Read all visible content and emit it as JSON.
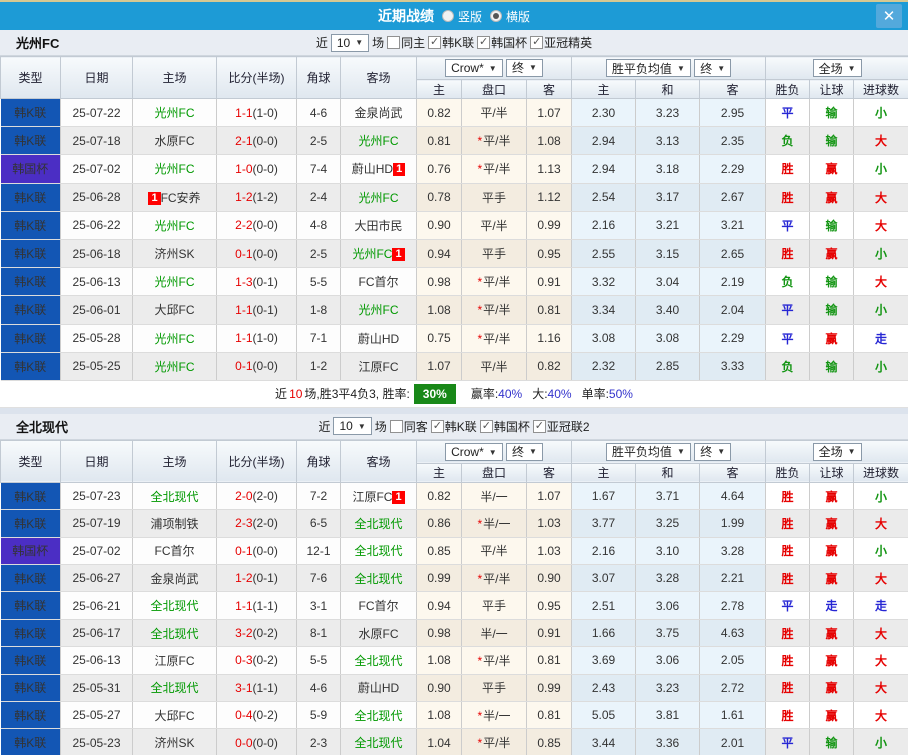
{
  "titlebar": {
    "title": "近期战绩",
    "radio_vertical": "竖版",
    "radio_horizontal": "横版",
    "radio_selected": "横版",
    "close_label": "X"
  },
  "table_header": {
    "left_cols": [
      "类型",
      "日期",
      "主场",
      "比分(半场)",
      "角球",
      "客场"
    ],
    "odds_provider_select": "Crow*",
    "final_select": "终",
    "odds_cols": [
      "主",
      "盘口",
      "客"
    ],
    "avg_select": "胜平负均值",
    "avg_final_select": "终",
    "avg_cols": [
      "主",
      "和",
      "客"
    ],
    "scope_select": "全场",
    "result_cols": [
      "胜负",
      "让球",
      "进球数"
    ]
  },
  "colors": {
    "titlebar": "#1d9bd6",
    "league_type": "#1356b4",
    "cup_type": "#4b2ec4",
    "focus_team": "#009900",
    "win_red": "#e60000",
    "draw_blue": "#2626d4",
    "loss_green": "#139513",
    "winrate_badge": "#188818"
  },
  "sections": [
    {
      "team": "光州FC",
      "filters": {
        "near_label": "近",
        "count": "10",
        "games_label": "场",
        "same_label": "同主",
        "same_checked": false,
        "leagues": [
          {
            "label": "韩K联",
            "checked": true
          },
          {
            "label": "韩国杯",
            "checked": true
          },
          {
            "label": "亚冠精英",
            "checked": true
          }
        ]
      },
      "rows": [
        {
          "type": "韩K联",
          "cup": false,
          "date": "25-07-22",
          "home": "光州FC",
          "hg": true,
          "hbadge": false,
          "score": "1-1",
          "half": "(1-0)",
          "corner": "4-6",
          "away": "金泉尚武",
          "ag": false,
          "abadge": false,
          "star": false,
          "odds": [
            "0.82",
            "平/半",
            "1.07"
          ],
          "avg": [
            "2.30",
            "3.23",
            "2.95"
          ],
          "res": [
            [
              "平",
              "b"
            ],
            [
              "输",
              "g"
            ],
            [
              "小",
              "g"
            ]
          ]
        },
        {
          "type": "韩K联",
          "cup": false,
          "date": "25-07-18",
          "home": "水原FC",
          "hg": false,
          "hbadge": false,
          "score": "2-1",
          "half": "(0-0)",
          "corner": "2-5",
          "away": "光州FC",
          "ag": true,
          "abadge": false,
          "star": true,
          "odds": [
            "0.81",
            "平/半",
            "1.08"
          ],
          "avg": [
            "2.94",
            "3.13",
            "2.35"
          ],
          "res": [
            [
              "负",
              "g"
            ],
            [
              "输",
              "g"
            ],
            [
              "大",
              "r"
            ]
          ]
        },
        {
          "type": "韩国杯",
          "cup": true,
          "date": "25-07-02",
          "home": "光州FC",
          "hg": true,
          "hbadge": false,
          "score": "1-0",
          "half": "(0-0)",
          "corner": "7-4",
          "away": "蔚山HD",
          "ag": false,
          "abadge": true,
          "star": true,
          "odds": [
            "0.76",
            "平/半",
            "1.13"
          ],
          "avg": [
            "2.94",
            "3.18",
            "2.29"
          ],
          "res": [
            [
              "胜",
              "r"
            ],
            [
              "赢",
              "r"
            ],
            [
              "小",
              "g"
            ]
          ]
        },
        {
          "type": "韩K联",
          "cup": false,
          "date": "25-06-28",
          "home": "FC安养",
          "hg": false,
          "hbadge": true,
          "score": "1-2",
          "half": "(1-2)",
          "corner": "2-4",
          "away": "光州FC",
          "ag": true,
          "abadge": false,
          "star": false,
          "odds": [
            "0.78",
            "平手",
            "1.12"
          ],
          "avg": [
            "2.54",
            "3.17",
            "2.67"
          ],
          "res": [
            [
              "胜",
              "r"
            ],
            [
              "赢",
              "r"
            ],
            [
              "大",
              "r"
            ]
          ]
        },
        {
          "type": "韩K联",
          "cup": false,
          "date": "25-06-22",
          "home": "光州FC",
          "hg": true,
          "hbadge": false,
          "score": "2-2",
          "half": "(0-0)",
          "corner": "4-8",
          "away": "大田市民",
          "ag": false,
          "abadge": false,
          "star": false,
          "odds": [
            "0.90",
            "平/半",
            "0.99"
          ],
          "avg": [
            "2.16",
            "3.21",
            "3.21"
          ],
          "res": [
            [
              "平",
              "b"
            ],
            [
              "输",
              "g"
            ],
            [
              "大",
              "r"
            ]
          ]
        },
        {
          "type": "韩K联",
          "cup": false,
          "date": "25-06-18",
          "home": "济州SK",
          "hg": false,
          "hbadge": false,
          "score": "0-1",
          "half": "(0-0)",
          "corner": "2-5",
          "away": "光州FC",
          "ag": true,
          "abadge": true,
          "star": false,
          "odds": [
            "0.94",
            "平手",
            "0.95"
          ],
          "avg": [
            "2.55",
            "3.15",
            "2.65"
          ],
          "res": [
            [
              "胜",
              "r"
            ],
            [
              "赢",
              "r"
            ],
            [
              "小",
              "g"
            ]
          ]
        },
        {
          "type": "韩K联",
          "cup": false,
          "date": "25-06-13",
          "home": "光州FC",
          "hg": true,
          "hbadge": false,
          "score": "1-3",
          "half": "(0-1)",
          "corner": "5-5",
          "away": "FC首尔",
          "ag": false,
          "abadge": false,
          "star": true,
          "odds": [
            "0.98",
            "平/半",
            "0.91"
          ],
          "avg": [
            "3.32",
            "3.04",
            "2.19"
          ],
          "res": [
            [
              "负",
              "g"
            ],
            [
              "输",
              "g"
            ],
            [
              "大",
              "r"
            ]
          ]
        },
        {
          "type": "韩K联",
          "cup": false,
          "date": "25-06-01",
          "home": "大邱FC",
          "hg": false,
          "hbadge": false,
          "score": "1-1",
          "half": "(0-1)",
          "corner": "1-8",
          "away": "光州FC",
          "ag": true,
          "abadge": false,
          "star": true,
          "odds": [
            "1.08",
            "平/半",
            "0.81"
          ],
          "avg": [
            "3.34",
            "3.40",
            "2.04"
          ],
          "res": [
            [
              "平",
              "b"
            ],
            [
              "输",
              "g"
            ],
            [
              "小",
              "g"
            ]
          ]
        },
        {
          "type": "韩K联",
          "cup": false,
          "date": "25-05-28",
          "home": "光州FC",
          "hg": true,
          "hbadge": false,
          "score": "1-1",
          "half": "(1-0)",
          "corner": "7-1",
          "away": "蔚山HD",
          "ag": false,
          "abadge": false,
          "star": true,
          "odds": [
            "0.75",
            "平/半",
            "1.16"
          ],
          "avg": [
            "3.08",
            "3.08",
            "2.29"
          ],
          "res": [
            [
              "平",
              "b"
            ],
            [
              "赢",
              "r"
            ],
            [
              "走",
              "b"
            ]
          ]
        },
        {
          "type": "韩K联",
          "cup": false,
          "date": "25-05-25",
          "home": "光州FC",
          "hg": true,
          "hbadge": false,
          "score": "0-1",
          "half": "(0-0)",
          "corner": "1-2",
          "away": "江原FC",
          "ag": false,
          "abadge": false,
          "star": false,
          "odds": [
            "1.07",
            "平/半",
            "0.82"
          ],
          "avg": [
            "2.32",
            "2.85",
            "3.33"
          ],
          "res": [
            [
              "负",
              "g"
            ],
            [
              "输",
              "g"
            ],
            [
              "小",
              "g"
            ]
          ]
        }
      ],
      "summary": {
        "near_label": "近",
        "count": "10",
        "mid_text": "场,胜3平4负3, 胜率:",
        "win_rate": "30%",
        "items": [
          {
            "label": "赢率:",
            "value": "40%"
          },
          {
            "label": "大:",
            "value": "40%"
          },
          {
            "label": "单率:",
            "value": "50%"
          }
        ]
      }
    },
    {
      "team": "全北现代",
      "filters": {
        "near_label": "近",
        "count": "10",
        "games_label": "场",
        "same_label": "同客",
        "same_checked": false,
        "leagues": [
          {
            "label": "韩K联",
            "checked": true
          },
          {
            "label": "韩国杯",
            "checked": true
          },
          {
            "label": "亚冠联2",
            "checked": true
          }
        ]
      },
      "rows": [
        {
          "type": "韩K联",
          "cup": false,
          "date": "25-07-23",
          "home": "全北现代",
          "hg": true,
          "hbadge": false,
          "score": "2-0",
          "half": "(2-0)",
          "corner": "7-2",
          "away": "江原FC",
          "ag": false,
          "abadge": true,
          "star": false,
          "odds": [
            "0.82",
            "半/一",
            "1.07"
          ],
          "avg": [
            "1.67",
            "3.71",
            "4.64"
          ],
          "res": [
            [
              "胜",
              "r"
            ],
            [
              "赢",
              "r"
            ],
            [
              "小",
              "g"
            ]
          ]
        },
        {
          "type": "韩K联",
          "cup": false,
          "date": "25-07-19",
          "home": "浦项制铁",
          "hg": false,
          "hbadge": false,
          "score": "2-3",
          "half": "(2-0)",
          "corner": "6-5",
          "away": "全北现代",
          "ag": true,
          "abadge": false,
          "star": true,
          "odds": [
            "0.86",
            "半/一",
            "1.03"
          ],
          "avg": [
            "3.77",
            "3.25",
            "1.99"
          ],
          "res": [
            [
              "胜",
              "r"
            ],
            [
              "赢",
              "r"
            ],
            [
              "大",
              "r"
            ]
          ]
        },
        {
          "type": "韩国杯",
          "cup": true,
          "date": "25-07-02",
          "home": "FC首尔",
          "hg": false,
          "hbadge": false,
          "score": "0-1",
          "half": "(0-0)",
          "corner": "12-1",
          "away": "全北现代",
          "ag": true,
          "abadge": false,
          "star": false,
          "odds": [
            "0.85",
            "平/半",
            "1.03"
          ],
          "avg": [
            "2.16",
            "3.10",
            "3.28"
          ],
          "res": [
            [
              "胜",
              "r"
            ],
            [
              "赢",
              "r"
            ],
            [
              "小",
              "g"
            ]
          ]
        },
        {
          "type": "韩K联",
          "cup": false,
          "date": "25-06-27",
          "home": "金泉尚武",
          "hg": false,
          "hbadge": false,
          "score": "1-2",
          "half": "(0-1)",
          "corner": "7-6",
          "away": "全北现代",
          "ag": true,
          "abadge": false,
          "star": true,
          "odds": [
            "0.99",
            "平/半",
            "0.90"
          ],
          "avg": [
            "3.07",
            "3.28",
            "2.21"
          ],
          "res": [
            [
              "胜",
              "r"
            ],
            [
              "赢",
              "r"
            ],
            [
              "大",
              "r"
            ]
          ]
        },
        {
          "type": "韩K联",
          "cup": false,
          "date": "25-06-21",
          "home": "全北现代",
          "hg": true,
          "hbadge": false,
          "score": "1-1",
          "half": "(1-1)",
          "corner": "3-1",
          "away": "FC首尔",
          "ag": false,
          "abadge": false,
          "star": false,
          "odds": [
            "0.94",
            "平手",
            "0.95"
          ],
          "avg": [
            "2.51",
            "3.06",
            "2.78"
          ],
          "res": [
            [
              "平",
              "b"
            ],
            [
              "走",
              "b"
            ],
            [
              "走",
              "b"
            ]
          ]
        },
        {
          "type": "韩K联",
          "cup": false,
          "date": "25-06-17",
          "home": "全北现代",
          "hg": true,
          "hbadge": false,
          "score": "3-2",
          "half": "(0-2)",
          "corner": "8-1",
          "away": "水原FC",
          "ag": false,
          "abadge": false,
          "star": false,
          "odds": [
            "0.98",
            "半/一",
            "0.91"
          ],
          "avg": [
            "1.66",
            "3.75",
            "4.63"
          ],
          "res": [
            [
              "胜",
              "r"
            ],
            [
              "赢",
              "r"
            ],
            [
              "大",
              "r"
            ]
          ]
        },
        {
          "type": "韩K联",
          "cup": false,
          "date": "25-06-13",
          "home": "江原FC",
          "hg": false,
          "hbadge": false,
          "score": "0-3",
          "half": "(0-2)",
          "corner": "5-5",
          "away": "全北现代",
          "ag": true,
          "abadge": false,
          "star": true,
          "odds": [
            "1.08",
            "平/半",
            "0.81"
          ],
          "avg": [
            "3.69",
            "3.06",
            "2.05"
          ],
          "res": [
            [
              "胜",
              "r"
            ],
            [
              "赢",
              "r"
            ],
            [
              "大",
              "r"
            ]
          ]
        },
        {
          "type": "韩K联",
          "cup": false,
          "date": "25-05-31",
          "home": "全北现代",
          "hg": true,
          "hbadge": false,
          "score": "3-1",
          "half": "(1-1)",
          "corner": "4-6",
          "away": "蔚山HD",
          "ag": false,
          "abadge": false,
          "star": false,
          "odds": [
            "0.90",
            "平手",
            "0.99"
          ],
          "avg": [
            "2.43",
            "3.23",
            "2.72"
          ],
          "res": [
            [
              "胜",
              "r"
            ],
            [
              "赢",
              "r"
            ],
            [
              "大",
              "r"
            ]
          ]
        },
        {
          "type": "韩K联",
          "cup": false,
          "date": "25-05-27",
          "home": "大邱FC",
          "hg": false,
          "hbadge": false,
          "score": "0-4",
          "half": "(0-2)",
          "corner": "5-9",
          "away": "全北现代",
          "ag": true,
          "abadge": false,
          "star": true,
          "odds": [
            "1.08",
            "半/一",
            "0.81"
          ],
          "avg": [
            "5.05",
            "3.81",
            "1.61"
          ],
          "res": [
            [
              "胜",
              "r"
            ],
            [
              "赢",
              "r"
            ],
            [
              "大",
              "r"
            ]
          ]
        },
        {
          "type": "韩K联",
          "cup": false,
          "date": "25-05-23",
          "home": "济州SK",
          "hg": false,
          "hbadge": false,
          "score": "0-0",
          "half": "(0-0)",
          "corner": "2-3",
          "away": "全北现代",
          "ag": true,
          "abadge": false,
          "star": true,
          "odds": [
            "1.04",
            "平/半",
            "0.85"
          ],
          "avg": [
            "3.44",
            "3.36",
            "2.01"
          ],
          "res": [
            [
              "平",
              "b"
            ],
            [
              "输",
              "g"
            ],
            [
              "小",
              "g"
            ]
          ]
        }
      ],
      "summary": null
    }
  ]
}
